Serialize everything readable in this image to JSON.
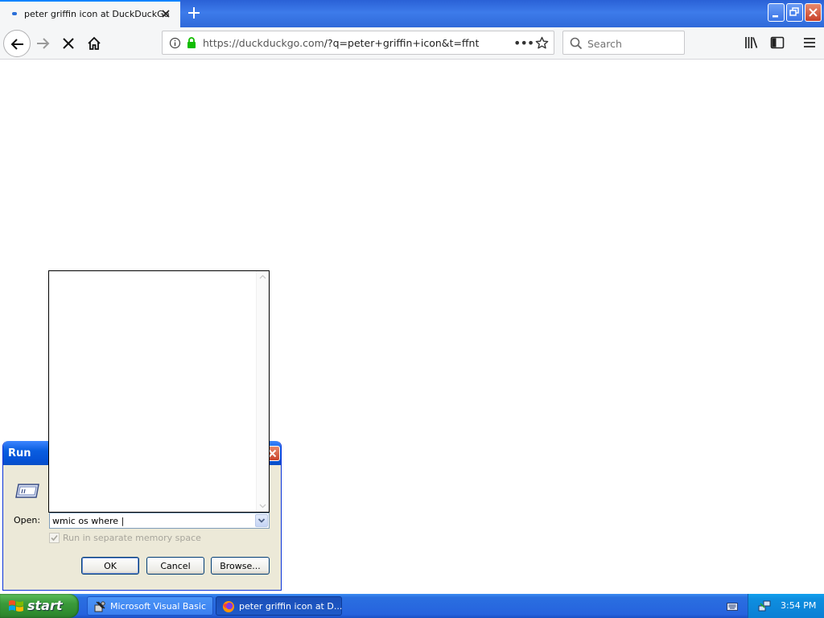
{
  "browser": {
    "tab_title": "peter griffin icon at DuckDuckGo",
    "url_host": "https://duckduckgo.com",
    "url_path": "/?q=peter+griffin+icon&t=ffnt",
    "search_placeholder": "Search",
    "page_actions": "•••"
  },
  "run_dialog": {
    "title": "Run",
    "open_label": "Open:",
    "command_value": "wmic os where |",
    "checkbox_label": "Run in separate memory space",
    "ok_label": "OK",
    "cancel_label": "Cancel",
    "browse_label": "Browse..."
  },
  "taskbar": {
    "start_label": "start",
    "tasks": [
      {
        "label": "Microsoft Visual Basic"
      },
      {
        "label": "peter griffin icon at D..."
      }
    ],
    "clock": "3:54 PM"
  },
  "colors": {
    "accent": "#0a84ff",
    "xp_blue": "#0552d6",
    "xp_green": "#3a9a3a",
    "lock_green": "#12bc00"
  }
}
